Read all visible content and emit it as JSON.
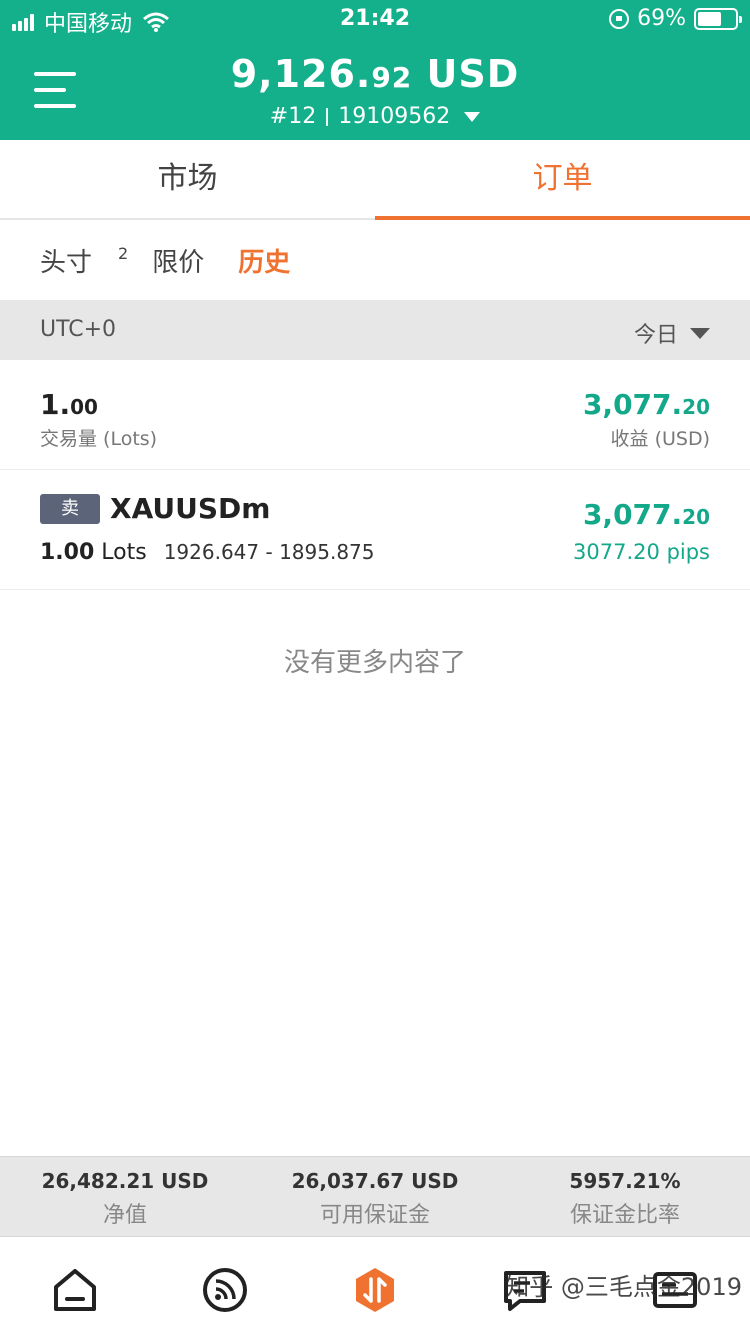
{
  "status_bar": {
    "carrier": "中国移动",
    "time": "21:42",
    "battery": "69%"
  },
  "header": {
    "balance_main": "9,126.",
    "balance_decimal": "92",
    "currency": "USD",
    "account_index": "#12",
    "account_number": "19109562"
  },
  "tabs": [
    {
      "label": "市场",
      "active": false
    },
    {
      "label": "订单",
      "active": true
    }
  ],
  "subtabs": {
    "positions_label": "头寸",
    "positions_count": "2",
    "pending_label": "限价",
    "history_label": "历史"
  },
  "filter": {
    "timezone": "UTC+0",
    "period": "今日"
  },
  "summary": {
    "volume_main": "1.",
    "volume_decimal": "00",
    "volume_label": "交易量 (Lots)",
    "profit_main": "3,077.",
    "profit_decimal": "20",
    "profit_label": "收益 (USD)"
  },
  "trades": [
    {
      "side": "卖",
      "symbol": "XAUUSDm",
      "lots": "1.00",
      "lots_unit": "Lots",
      "price_range": "1926.647 - 1895.875",
      "profit_main": "3,077.",
      "profit_decimal": "20",
      "pips": "3077.20 pips"
    }
  ],
  "empty_message": "没有更多内容了",
  "account_stats": [
    {
      "value": "26,482.21 USD",
      "label": "净值"
    },
    {
      "value": "26,037.67 USD",
      "label": "可用保证金"
    },
    {
      "value": "5957.21%",
      "label": "保证金比率"
    }
  ],
  "watermark": "知乎 @三毛点金2019",
  "colors": {
    "header_green": "#14b08b",
    "accent_orange": "#f07230",
    "profit_green": "#14a88a",
    "sell_badge": "#5b6478"
  }
}
